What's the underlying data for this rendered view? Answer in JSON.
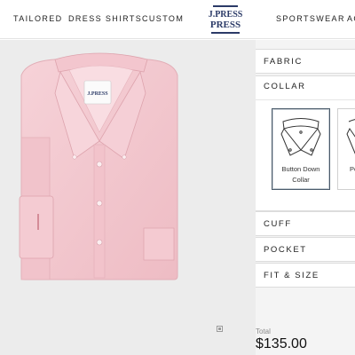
{
  "nav": {
    "items": [
      {
        "label": "TAILORED"
      },
      {
        "label": "DRESS SHIRTS"
      },
      {
        "label": "CUSTOM"
      },
      {
        "label": "SPORTSWEAR"
      },
      {
        "label": "AC"
      }
    ],
    "logo_text": "J.PRESS"
  },
  "product": {
    "image_name": "pink-oxford-button-down-shirt",
    "shirt_color": "#f3c9cf",
    "label_text": "J.PRESS"
  },
  "panel": {
    "sections": {
      "fabric": "FABRIC",
      "collar": "COLLAR",
      "cuff": "CUFF",
      "pocket": "POCKET",
      "fit_size": "FIT & SIZE"
    },
    "collar_options": [
      {
        "label_line1": "Button Down",
        "label_line2": "Collar",
        "selected": true
      },
      {
        "label_line1": "Po",
        "label_line2": "",
        "selected": false
      }
    ]
  },
  "total": {
    "label": "Total",
    "price": "$135.00"
  },
  "colors": {
    "logo_navy": "#2b3a67",
    "panel_bg": "#f4f4f4",
    "image_bg": "#ececec"
  }
}
